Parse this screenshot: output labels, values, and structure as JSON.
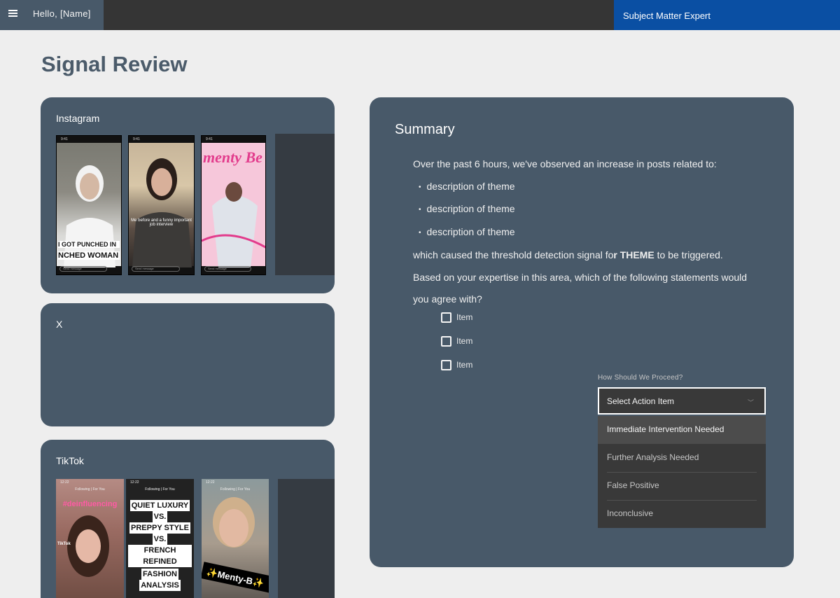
{
  "header": {
    "greeting": "Hello, [Name]",
    "role": "Subject Matter Expert"
  },
  "page": {
    "title": "Signal Review"
  },
  "platforms": {
    "instagram": {
      "title": "Instagram",
      "posts": [
        {
          "time": "9:41",
          "caption": "I GOT PUNCHED IN",
          "caption2": "NCHED WOMAN IN T",
          "message": "Send message"
        },
        {
          "time": "9:41",
          "caption": "Me before and a funny important job interview",
          "message": "Send message"
        },
        {
          "time": "9:41",
          "caption": "menty Be",
          "message": "Send message"
        }
      ]
    },
    "x": {
      "title": "X"
    },
    "tiktok": {
      "title": "TikTok",
      "posts": [
        {
          "time": "12:22",
          "tabs": "Following  |  For You",
          "caption": "#deinfluencing",
          "brand": "TikTok"
        },
        {
          "time": "12:22",
          "tabs": "Following  |  For You",
          "lines": [
            "QUIET LUXURY",
            "VS.",
            "PREPPY STYLE",
            "VS.",
            "FRENCH REFINED"
          ],
          "lines2": [
            "FASHION",
            "ANALYSIS"
          ]
        },
        {
          "time": "12:22",
          "tabs": "Following  |  For You",
          "caption": "✨Menty-B✨"
        }
      ]
    }
  },
  "summary": {
    "title": "Summary",
    "intro": "Over the past 6 hours, we've observed an increase in posts related to:",
    "themes": [
      "description of theme",
      "description of theme",
      "description of theme"
    ],
    "threshold_prefix": "which caused the threshold detection signal fo",
    "threshold_r": "r ",
    "threshold_theme": "THEME",
    "threshold_suffix": " to be triggered.",
    "question_line1": "Based on your expertise in this area, which of the following statements would",
    "question_line2": "you agree with?",
    "items": [
      {
        "label": "Item",
        "checked": false
      },
      {
        "label": "Item",
        "checked": false
      },
      {
        "label": "Item",
        "checked": false
      }
    ]
  },
  "action": {
    "label": "How Should We Proceed?",
    "placeholder": "Select Action Item",
    "options": [
      "Immediate Intervention Needed",
      "Further Analysis Needed",
      "False Positive",
      "Inconclusive"
    ]
  }
}
